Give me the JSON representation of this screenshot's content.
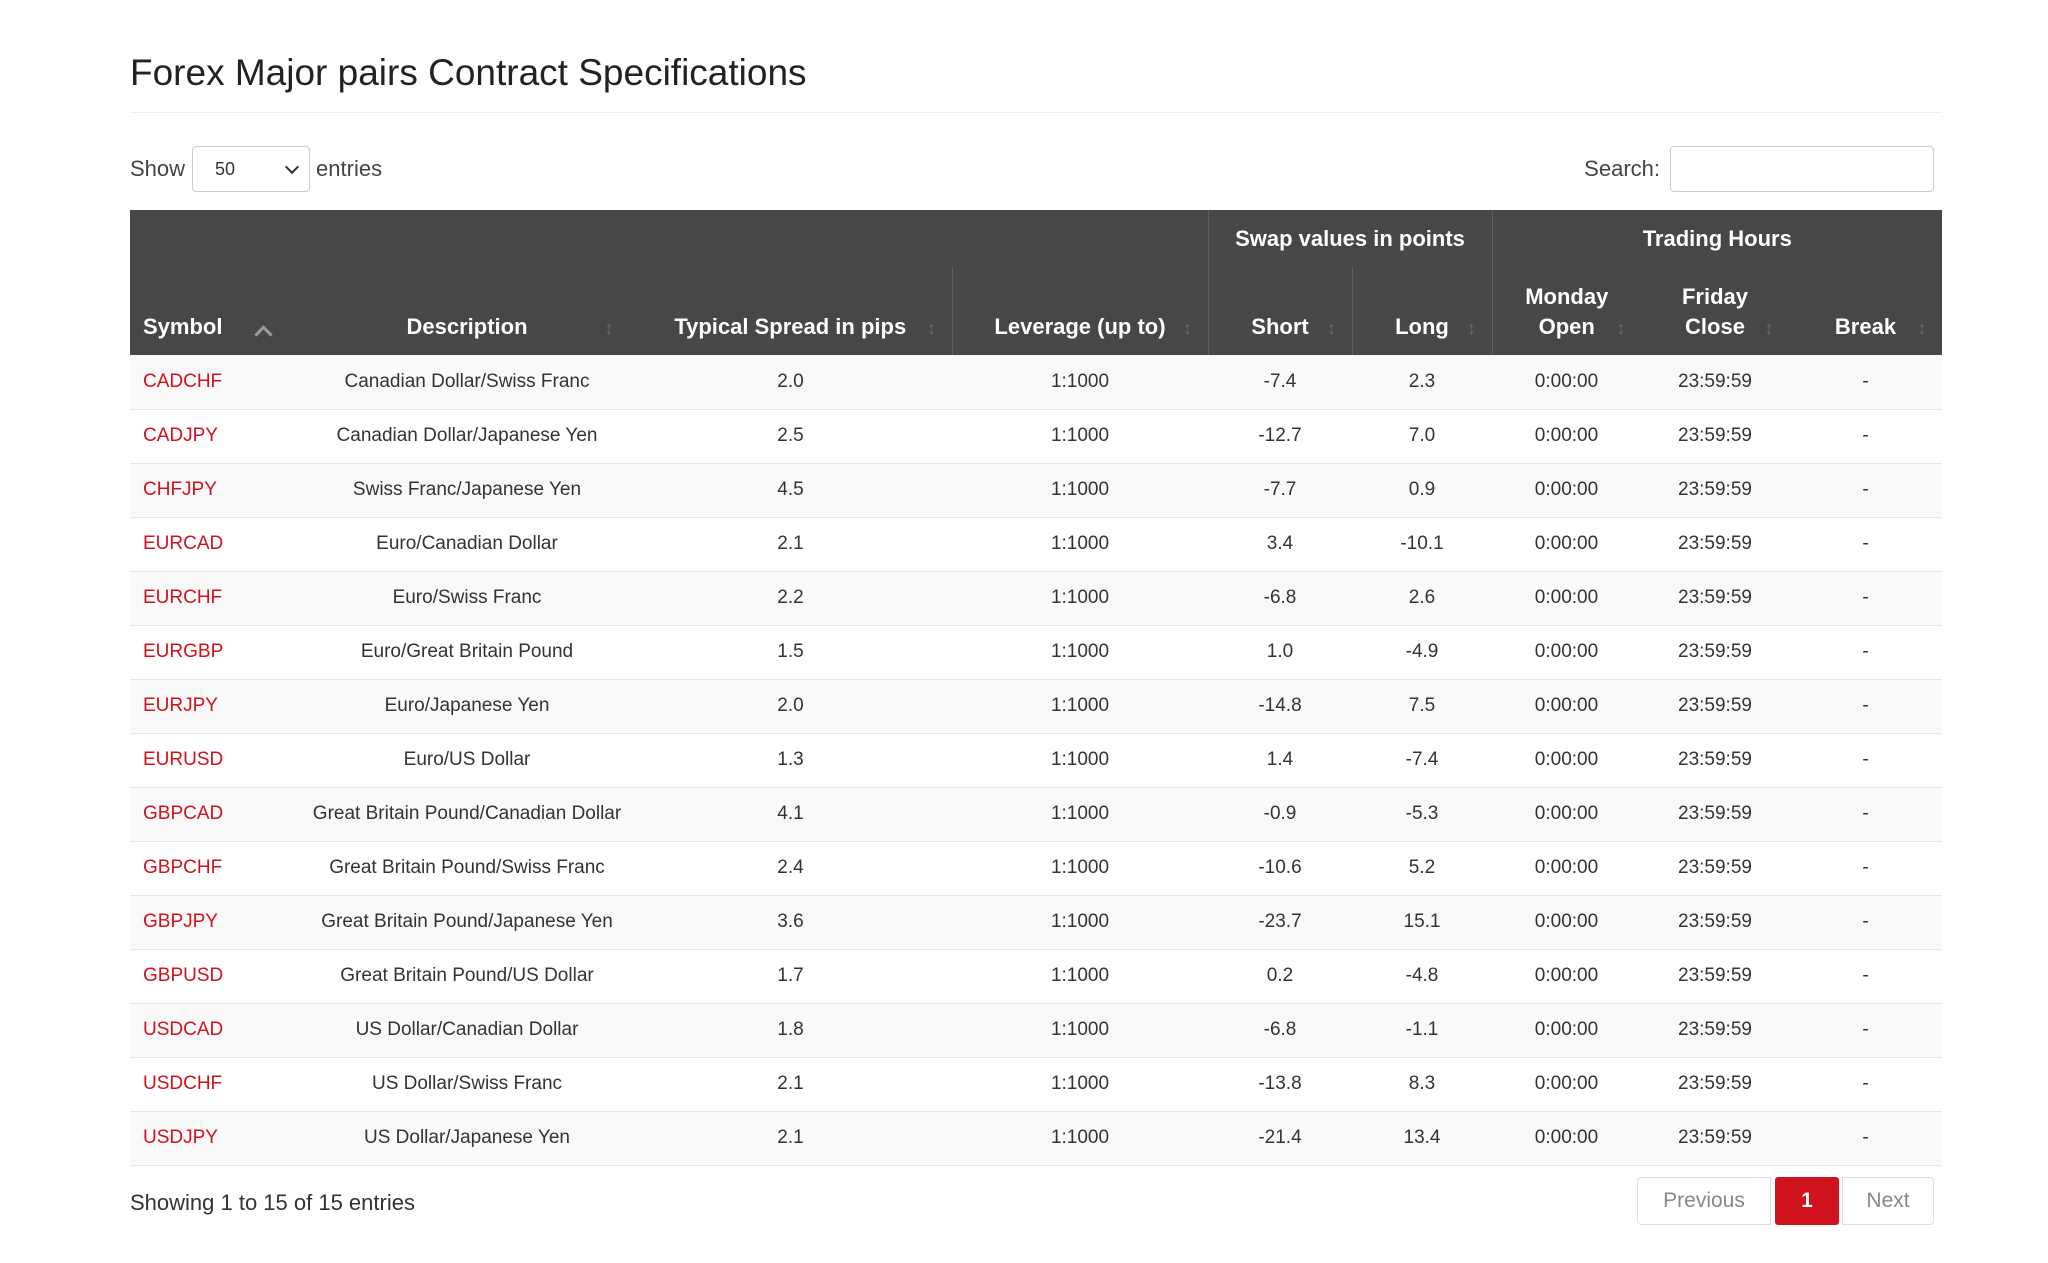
{
  "page": {
    "title": "Forex Major pairs Contract Specifications"
  },
  "length_control": {
    "show_label": "Show",
    "selected": "50",
    "entries_label": "entries"
  },
  "search": {
    "label": "Search:",
    "value": "",
    "placeholder": ""
  },
  "table": {
    "group_headers": {
      "swap": "Swap values in points",
      "trading_hours": "Trading Hours"
    },
    "columns": {
      "symbol": "Symbol",
      "description": "Description",
      "spread": "Typical Spread in pips",
      "leverage": "Leverage (up to)",
      "short": "Short",
      "long": "Long",
      "monday_open_1": "Monday",
      "monday_open_2": "Open",
      "friday_close_1": "Friday",
      "friday_close_2": "Close",
      "break": "Break"
    },
    "rows": [
      {
        "symbol": "CADCHF",
        "description": "Canadian Dollar/Swiss Franc",
        "spread": "2.0",
        "leverage": "1:1000",
        "short": "-7.4",
        "long": "2.3",
        "open": "0:00:00",
        "close": "23:59:59",
        "break": "-"
      },
      {
        "symbol": "CADJPY",
        "description": "Canadian Dollar/Japanese Yen",
        "spread": "2.5",
        "leverage": "1:1000",
        "short": "-12.7",
        "long": "7.0",
        "open": "0:00:00",
        "close": "23:59:59",
        "break": "-"
      },
      {
        "symbol": "CHFJPY",
        "description": "Swiss Franc/Japanese Yen",
        "spread": "4.5",
        "leverage": "1:1000",
        "short": "-7.7",
        "long": "0.9",
        "open": "0:00:00",
        "close": "23:59:59",
        "break": "-"
      },
      {
        "symbol": "EURCAD",
        "description": "Euro/Canadian Dollar",
        "spread": "2.1",
        "leverage": "1:1000",
        "short": "3.4",
        "long": "-10.1",
        "open": "0:00:00",
        "close": "23:59:59",
        "break": "-"
      },
      {
        "symbol": "EURCHF",
        "description": "Euro/Swiss Franc",
        "spread": "2.2",
        "leverage": "1:1000",
        "short": "-6.8",
        "long": "2.6",
        "open": "0:00:00",
        "close": "23:59:59",
        "break": "-"
      },
      {
        "symbol": "EURGBP",
        "description": "Euro/Great Britain Pound",
        "spread": "1.5",
        "leverage": "1:1000",
        "short": "1.0",
        "long": "-4.9",
        "open": "0:00:00",
        "close": "23:59:59",
        "break": "-"
      },
      {
        "symbol": "EURJPY",
        "description": "Euro/Japanese Yen",
        "spread": "2.0",
        "leverage": "1:1000",
        "short": "-14.8",
        "long": "7.5",
        "open": "0:00:00",
        "close": "23:59:59",
        "break": "-"
      },
      {
        "symbol": "EURUSD",
        "description": "Euro/US Dollar",
        "spread": "1.3",
        "leverage": "1:1000",
        "short": "1.4",
        "long": "-7.4",
        "open": "0:00:00",
        "close": "23:59:59",
        "break": "-"
      },
      {
        "symbol": "GBPCAD",
        "description": "Great Britain Pound/Canadian Dollar",
        "spread": "4.1",
        "leverage": "1:1000",
        "short": "-0.9",
        "long": "-5.3",
        "open": "0:00:00",
        "close": "23:59:59",
        "break": "-"
      },
      {
        "symbol": "GBPCHF",
        "description": "Great Britain Pound/Swiss Franc",
        "spread": "2.4",
        "leverage": "1:1000",
        "short": "-10.6",
        "long": "5.2",
        "open": "0:00:00",
        "close": "23:59:59",
        "break": "-"
      },
      {
        "symbol": "GBPJPY",
        "description": "Great Britain Pound/Japanese Yen",
        "spread": "3.6",
        "leverage": "1:1000",
        "short": "-23.7",
        "long": "15.1",
        "open": "0:00:00",
        "close": "23:59:59",
        "break": "-"
      },
      {
        "symbol": "GBPUSD",
        "description": "Great Britain Pound/US Dollar",
        "spread": "1.7",
        "leverage": "1:1000",
        "short": "0.2",
        "long": "-4.8",
        "open": "0:00:00",
        "close": "23:59:59",
        "break": "-"
      },
      {
        "symbol": "USDCAD",
        "description": "US Dollar/Canadian Dollar",
        "spread": "1.8",
        "leverage": "1:1000",
        "short": "-6.8",
        "long": "-1.1",
        "open": "0:00:00",
        "close": "23:59:59",
        "break": "-"
      },
      {
        "symbol": "USDCHF",
        "description": "US Dollar/Swiss Franc",
        "spread": "2.1",
        "leverage": "1:1000",
        "short": "-13.8",
        "long": "8.3",
        "open": "0:00:00",
        "close": "23:59:59",
        "break": "-"
      },
      {
        "symbol": "USDJPY",
        "description": "US Dollar/Japanese Yen",
        "spread": "2.1",
        "leverage": "1:1000",
        "short": "-21.4",
        "long": "13.4",
        "open": "0:00:00",
        "close": "23:59:59",
        "break": "-"
      }
    ]
  },
  "footer": {
    "info": "Showing 1 to 15 of 15 entries",
    "pagination": {
      "previous": "Previous",
      "current": "1",
      "next": "Next"
    }
  },
  "colors": {
    "accent": "#d0121d",
    "header_bg": "#474747"
  }
}
